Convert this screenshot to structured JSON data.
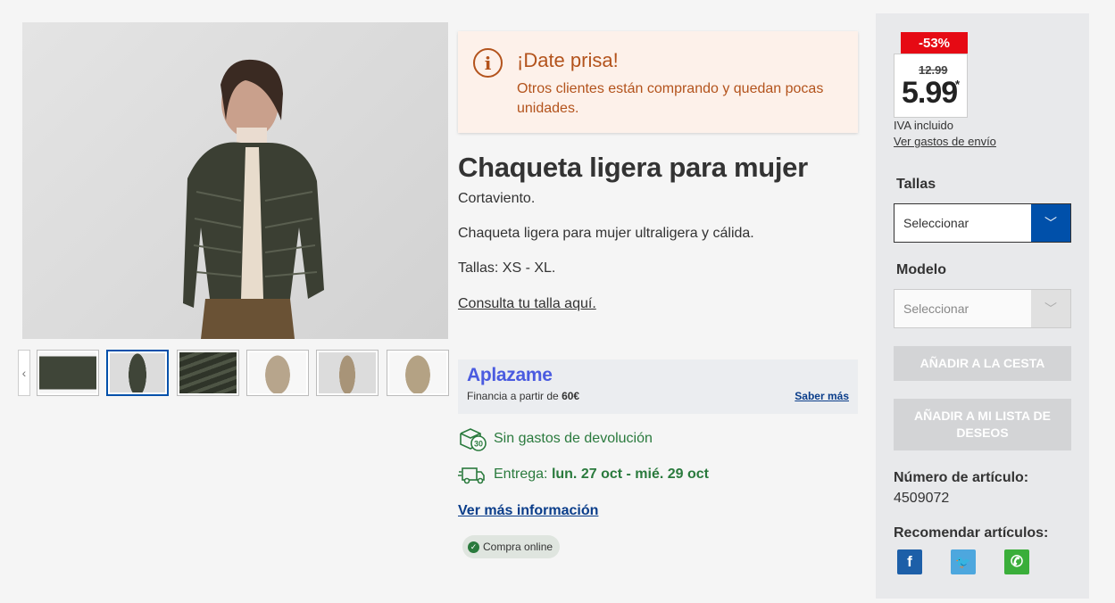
{
  "gallery": {
    "prev_icon": "chevron-left-icon",
    "prev_glyph": "‹"
  },
  "urgency": {
    "icon": "info-icon",
    "icon_glyph": "i",
    "title": "¡Date prisa!",
    "message": "Otros clientes están comprando y quedan pocas unidades."
  },
  "product": {
    "title": "Chaqueta ligera para mujer",
    "desc_lines": [
      "Cortaviento.",
      "Chaqueta ligera para mujer ultraligera y cálida.",
      "Tallas: XS - XL."
    ],
    "size_link": "Consulta tu talla aquí."
  },
  "aplazame": {
    "logo": "Aplazame",
    "financing_prefix": "Financia a partir de",
    "financing_amount": "60€",
    "more_link": "Saber más"
  },
  "features": {
    "returns": "Sin gastos de devolución",
    "delivery_label": "Entrega:",
    "delivery_dates": "lun. 27 oct - mié. 29 oct",
    "returns_icon": "box-return-30-icon",
    "delivery_icon": "delivery-truck-icon"
  },
  "more_info": "Ver más información",
  "online_badge": "Compra online",
  "panel": {
    "discount": "-53%",
    "old_price": "12.99",
    "price": "5.99",
    "price_star": "*",
    "vat": "IVA incluido",
    "shipping_link": "Ver gastos de envío",
    "size_label": "Tallas",
    "size_value": "Seleccionar",
    "model_label": "Modelo",
    "model_value": "Seleccionar",
    "add_cart": "AÑADIR A LA CESTA",
    "add_wishlist": "AÑADIR A MI LISTA DE DESEOS",
    "article_label": "Número de artículo:",
    "article_number": "4509072",
    "recommend_label": "Recomendar artículos:",
    "social": [
      {
        "name": "facebook-icon",
        "glyph": "f",
        "color": "#1d5fa8"
      },
      {
        "name": "twitter-icon",
        "glyph": "🐦",
        "color": "#4da7de"
      },
      {
        "name": "whatsapp-icon",
        "glyph": "✆",
        "color": "#3aae3a"
      }
    ]
  },
  "colors": {
    "brand_blue": "#0050aa",
    "sale_red": "#e60a14",
    "urgency_text": "#b3531c",
    "success_green": "#2a7a3d"
  }
}
